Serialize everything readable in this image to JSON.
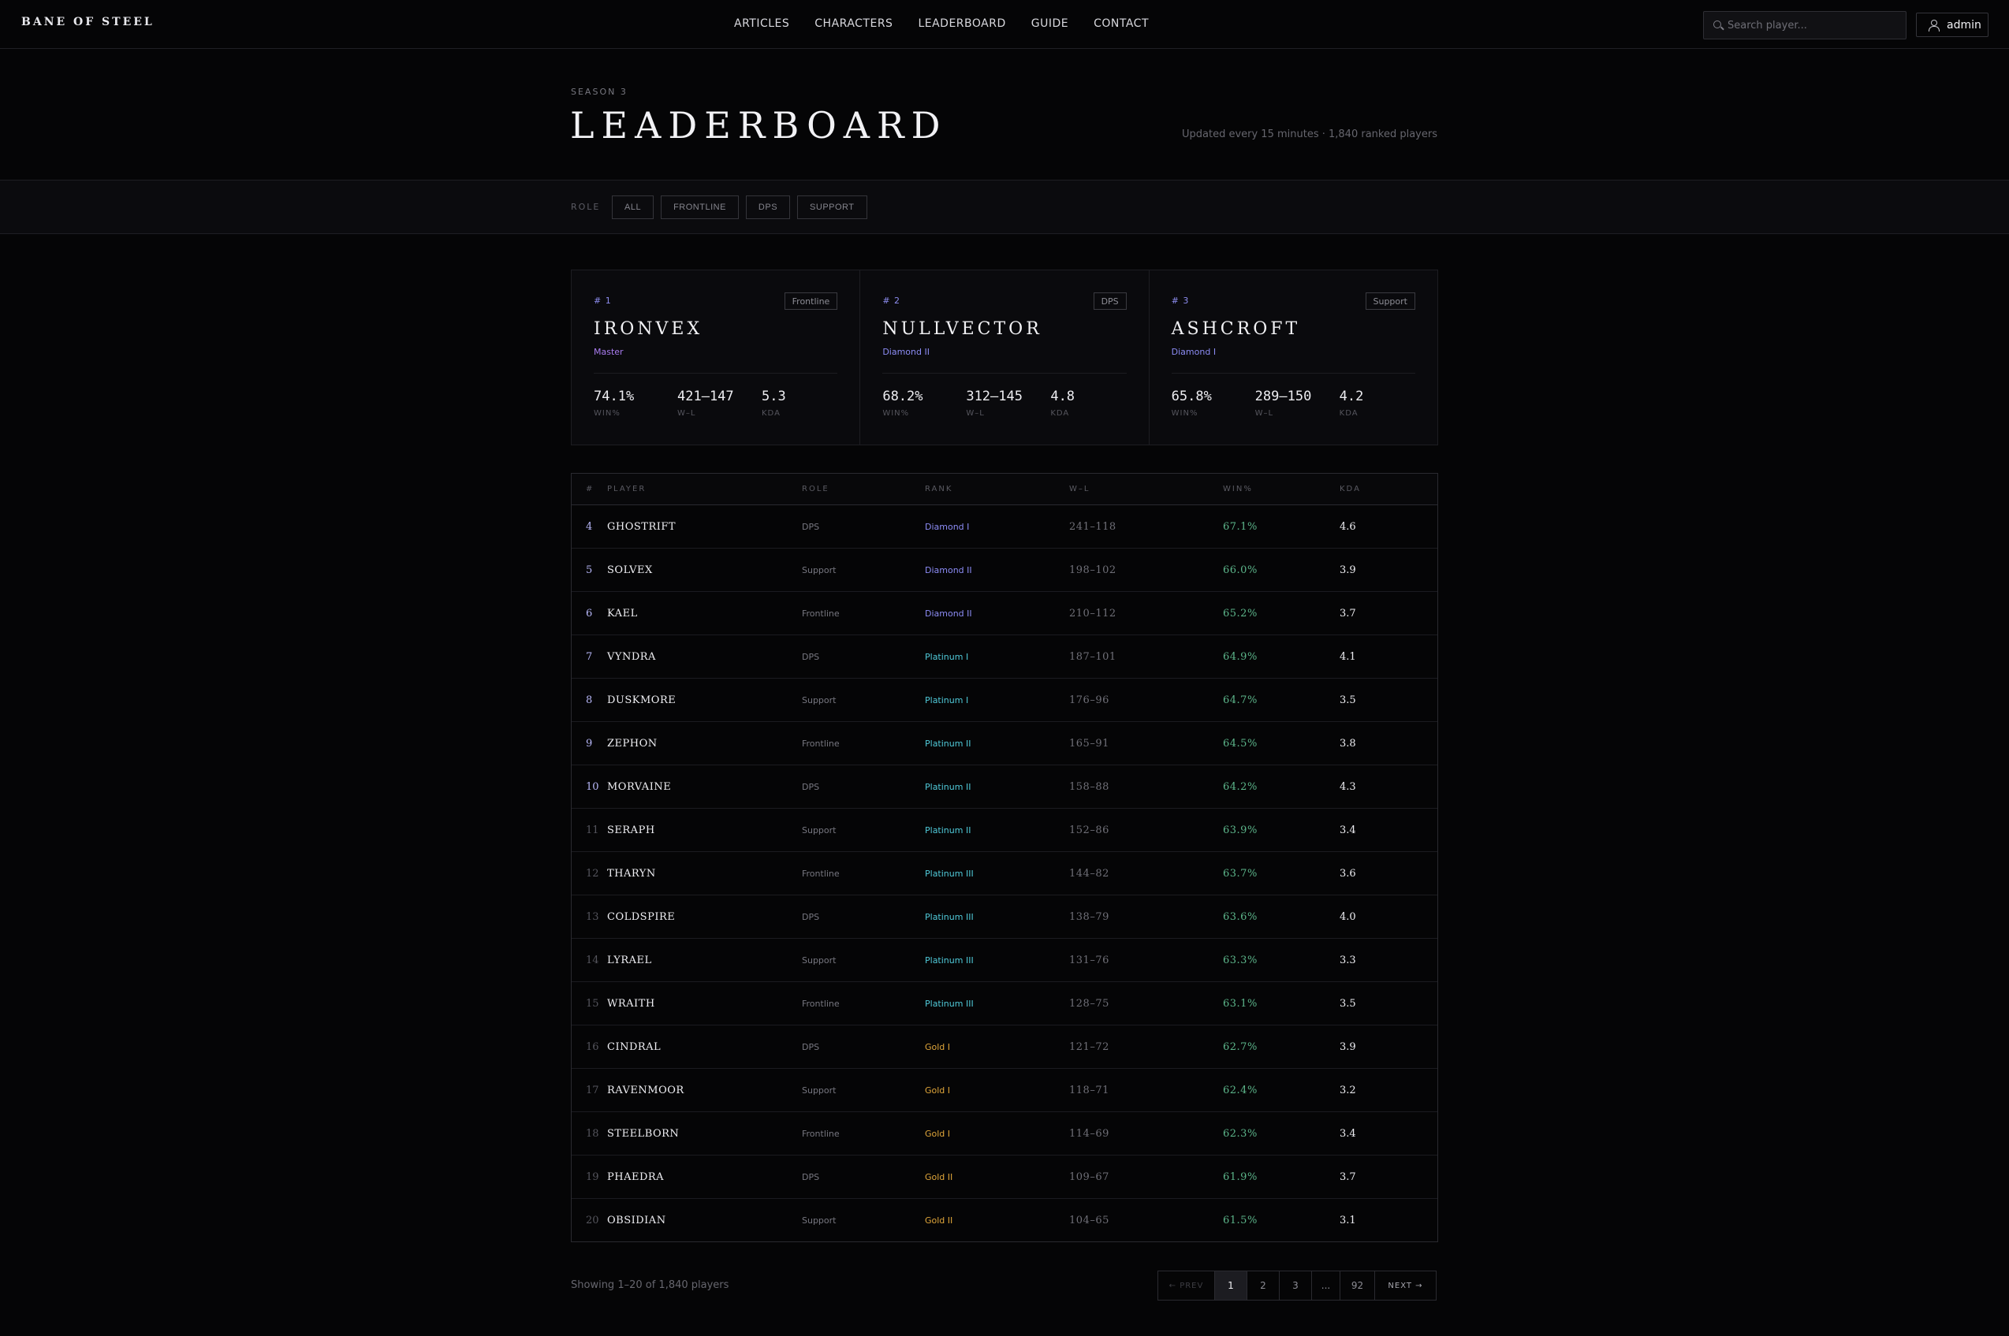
{
  "brand": "BANE OF STEEL",
  "nav": [
    "ARTICLES",
    "CHARACTERS",
    "LEADERBOARD",
    "GUIDE",
    "CONTACT"
  ],
  "search": {
    "placeholder": "Search player..."
  },
  "user": {
    "name": "admin"
  },
  "header": {
    "season": "SEASON 3",
    "title": "LEADERBOARD",
    "updated": "Updated every 15 minutes  ·  1,840 ranked players"
  },
  "filters": {
    "label": "ROLE",
    "options": [
      "ALL",
      "FRONTLINE",
      "DPS",
      "SUPPORT"
    ]
  },
  "stat_labels": {
    "win": "WIN%",
    "wl": "W–L",
    "kda": "KDA"
  },
  "tier_colors": {
    "master": "#a97cf0",
    "diamond": "#8c8cf5",
    "platinum": "#4fc9d8",
    "gold": "#e0a63a"
  },
  "podium": [
    {
      "rank": "# 1",
      "role": "Frontline",
      "name": "IRONVEX",
      "tier": "Master",
      "tier_type": "master",
      "win": "74.1%",
      "wl": "421–147",
      "kda": "5.3"
    },
    {
      "rank": "# 2",
      "role": "DPS",
      "name": "NULLVECTOR",
      "tier": "Diamond II",
      "tier_type": "diamond",
      "win": "68.2%",
      "wl": "312–145",
      "kda": "4.8"
    },
    {
      "rank": "# 3",
      "role": "Support",
      "name": "ASHCROFT",
      "tier": "Diamond I",
      "tier_type": "diamond",
      "win": "65.8%",
      "wl": "289–150",
      "kda": "4.2"
    }
  ],
  "table": {
    "headers": [
      "#",
      "PLAYER",
      "ROLE",
      "RANK",
      "W–L",
      "WIN%",
      "KDA"
    ],
    "rows": [
      {
        "num": "4",
        "player": "GHOSTRIFT",
        "role": "DPS",
        "rank": "Diamond I",
        "tier_type": "diamond",
        "wl": "241–118",
        "win": "67.1%",
        "kda": "4.6"
      },
      {
        "num": "5",
        "player": "SOLVEX",
        "role": "Support",
        "rank": "Diamond II",
        "tier_type": "diamond",
        "wl": "198–102",
        "win": "66.0%",
        "kda": "3.9"
      },
      {
        "num": "6",
        "player": "KAEL",
        "role": "Frontline",
        "rank": "Diamond II",
        "tier_type": "diamond",
        "wl": "210–112",
        "win": "65.2%",
        "kda": "3.7"
      },
      {
        "num": "7",
        "player": "VYNDRA",
        "role": "DPS",
        "rank": "Platinum I",
        "tier_type": "platinum",
        "wl": "187–101",
        "win": "64.9%",
        "kda": "4.1"
      },
      {
        "num": "8",
        "player": "DUSKMORE",
        "role": "Support",
        "rank": "Platinum I",
        "tier_type": "platinum",
        "wl": "176–96",
        "win": "64.7%",
        "kda": "3.5"
      },
      {
        "num": "9",
        "player": "ZEPHON",
        "role": "Frontline",
        "rank": "Platinum II",
        "tier_type": "platinum",
        "wl": "165–91",
        "win": "64.5%",
        "kda": "3.8"
      },
      {
        "num": "10",
        "player": "MORVAINE",
        "role": "DPS",
        "rank": "Platinum II",
        "tier_type": "platinum",
        "wl": "158–88",
        "win": "64.2%",
        "kda": "4.3"
      },
      {
        "num": "11",
        "player": "SERAPH",
        "role": "Support",
        "rank": "Platinum II",
        "tier_type": "platinum",
        "wl": "152–86",
        "win": "63.9%",
        "kda": "3.4"
      },
      {
        "num": "12",
        "player": "THARYN",
        "role": "Frontline",
        "rank": "Platinum III",
        "tier_type": "platinum",
        "wl": "144–82",
        "win": "63.7%",
        "kda": "3.6"
      },
      {
        "num": "13",
        "player": "COLDSPIRE",
        "role": "DPS",
        "rank": "Platinum III",
        "tier_type": "platinum",
        "wl": "138–79",
        "win": "63.6%",
        "kda": "4.0"
      },
      {
        "num": "14",
        "player": "LYRAEL",
        "role": "Support",
        "rank": "Platinum III",
        "tier_type": "platinum",
        "wl": "131–76",
        "win": "63.3%",
        "kda": "3.3"
      },
      {
        "num": "15",
        "player": "WRAITH",
        "role": "Frontline",
        "rank": "Platinum III",
        "tier_type": "platinum",
        "wl": "128–75",
        "win": "63.1%",
        "kda": "3.5"
      },
      {
        "num": "16",
        "player": "CINDRAL",
        "role": "DPS",
        "rank": "Gold I",
        "tier_type": "gold",
        "wl": "121–72",
        "win": "62.7%",
        "kda": "3.9"
      },
      {
        "num": "17",
        "player": "RAVENMOOR",
        "role": "Support",
        "rank": "Gold I",
        "tier_type": "gold",
        "wl": "118–71",
        "win": "62.4%",
        "kda": "3.2"
      },
      {
        "num": "18",
        "player": "STEELBORN",
        "role": "Frontline",
        "rank": "Gold I",
        "tier_type": "gold",
        "wl": "114–69",
        "win": "62.3%",
        "kda": "3.4"
      },
      {
        "num": "19",
        "player": "PHAEDRA",
        "role": "DPS",
        "rank": "Gold II",
        "tier_type": "gold",
        "wl": "109–67",
        "win": "61.9%",
        "kda": "3.7"
      },
      {
        "num": "20",
        "player": "OBSIDIAN",
        "role": "Support",
        "rank": "Gold II",
        "tier_type": "gold",
        "wl": "104–65",
        "win": "61.5%",
        "kda": "3.1"
      }
    ]
  },
  "footer": {
    "showing": "Showing 1–20 of 1,840 players",
    "prev": "← PREV",
    "pages": [
      "1",
      "2",
      "3",
      "...",
      "92"
    ],
    "next": "NEXT →"
  }
}
